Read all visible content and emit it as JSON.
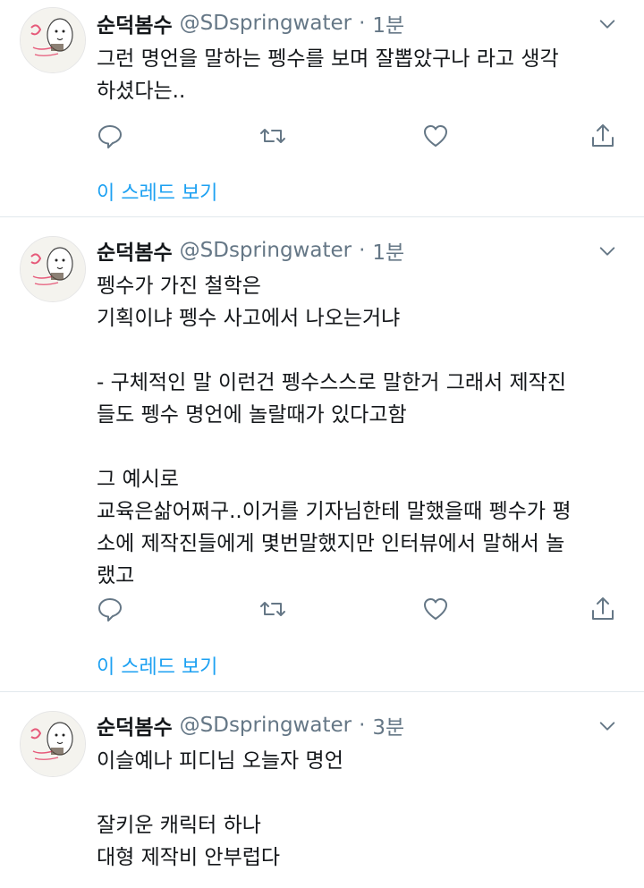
{
  "colors": {
    "link": "#1da1f2",
    "muted": "#657786",
    "divider": "#e1e8ed"
  },
  "tweets": [
    {
      "name": "순덕봄수",
      "handle": "@SDspringwater",
      "dot": "·",
      "time": "1분",
      "lines": [
        "그런 명언을 말하는 펭수를 보며 잘뽑았구나 라고 생각",
        "하셨다는.."
      ],
      "thread_label": "이 스레드 보기"
    },
    {
      "name": "순덕봄수",
      "handle": "@SDspringwater",
      "dot": "·",
      "time": "1분",
      "lines": [
        "펭수가 가진 철학은",
        "기획이냐  펭수 사고에서 나오는거냐",
        "",
        "- 구체적인 말 이런건 펭수스스로 말한거 그래서 제작진",
        "들도 펭수 명언에 놀랄때가 있다고함",
        "",
        "그 예시로",
        "교육은삶어쩌구..이거를 기자님한테 말했을때 펭수가 평",
        "소에 제작진들에게 몇번말했지만 인터뷰에서 말해서 놀",
        "랬고"
      ],
      "thread_label": "이 스레드 보기"
    },
    {
      "name": "순덕봄수",
      "handle": "@SDspringwater",
      "dot": "·",
      "time": "3분",
      "lines": [
        "이슬예나 피디님 오늘자 명언",
        "",
        "잘키운 캐릭터 하나",
        "대형 제작비 안부럽다"
      ]
    }
  ]
}
